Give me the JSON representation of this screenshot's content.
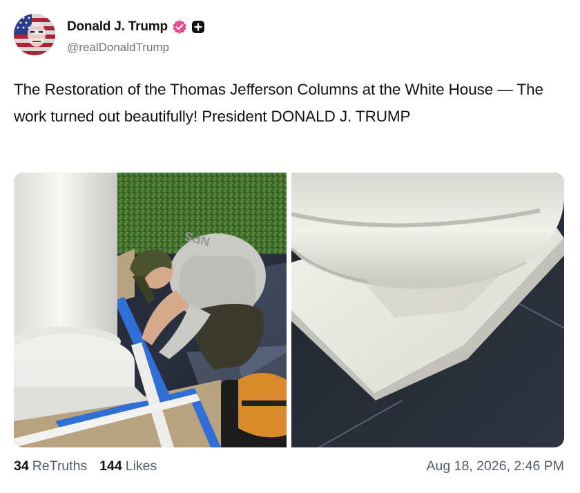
{
  "author": {
    "display_name": "Donald J. Trump",
    "handle": "@realDonaldTrump",
    "verified_icon": "verified-badge-icon",
    "plus_icon": "plus-badge-icon"
  },
  "post": {
    "text": "The Restoration of the Thomas Jefferson Columns at the White House — The work turned out beautifully! President DONALD J. TRUMP"
  },
  "media": {
    "images": [
      {
        "name": "column-restoration-worker-photo",
        "shirt_text": "NPS"
      },
      {
        "name": "column-base-closeup-photo"
      }
    ]
  },
  "stats": {
    "retruths_count": "34",
    "retruths_label": "ReTruths",
    "likes_count": "144",
    "likes_label": "Likes"
  },
  "timestamp": "Aug 18, 2026, 2:46 PM",
  "colors": {
    "verified": "#e84a8a",
    "text": "#111111",
    "muted": "#6b6f76"
  }
}
